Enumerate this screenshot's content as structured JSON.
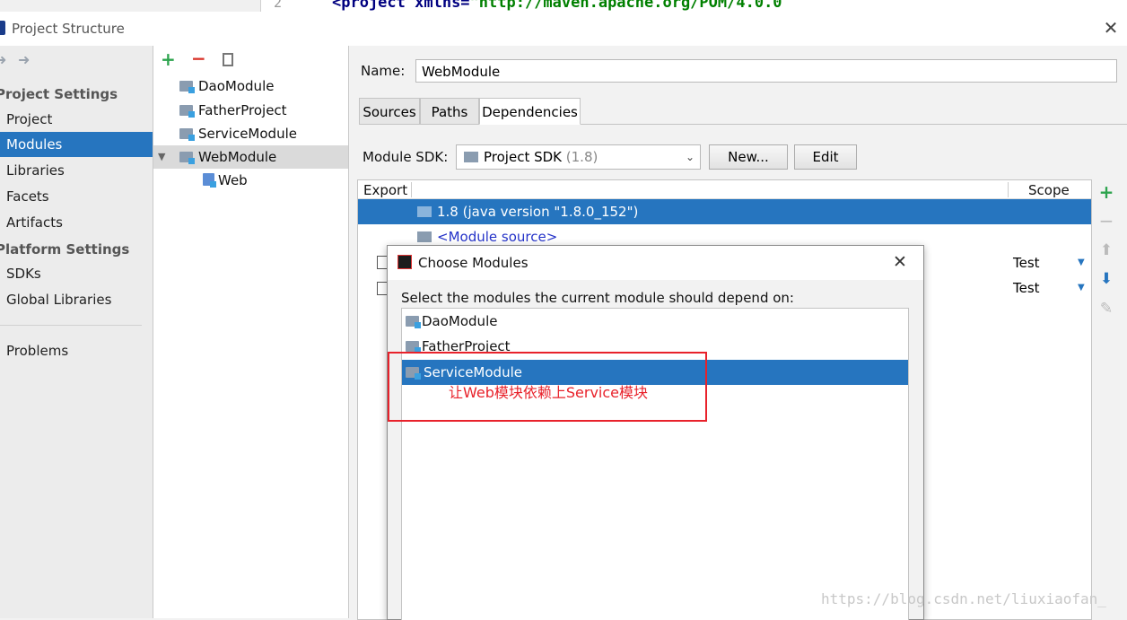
{
  "editor": {
    "line_number": "2",
    "code_prefix": "<project ",
    "code_attr": "xmlns=",
    "code_value": "\"http://maven.apache.org/POM/4.0.0"
  },
  "window": {
    "title": "Project Structure"
  },
  "nav": {
    "project_settings_header": "Project Settings",
    "project_items": [
      "Project",
      "Modules",
      "Libraries",
      "Facets",
      "Artifacts"
    ],
    "selected_item": "Modules",
    "platform_settings_header": "Platform Settings",
    "platform_items": [
      "SDKs",
      "Global Libraries"
    ],
    "problems": "Problems"
  },
  "tree": {
    "modules": [
      "DaoModule",
      "FatherProject",
      "ServiceModule",
      "WebModule"
    ],
    "selected": "WebModule",
    "child": "Web"
  },
  "details": {
    "name_label": "Name:",
    "name_value": "WebModule",
    "tabs": [
      "Sources",
      "Paths",
      "Dependencies"
    ],
    "active_tab": "Dependencies",
    "sdk_label": "Module SDK:",
    "sdk_value": "Project SDK",
    "sdk_version": "(1.8)",
    "new_button": "New...",
    "edit_button": "Edit",
    "col_export": "Export",
    "col_scope": "Scope",
    "dep_jdk": "1.8 (java version \"1.8.0_152\")",
    "dep_module_source": "<Module source>",
    "scope_row1": "Test",
    "scope_row2": "Test"
  },
  "dialog": {
    "title": "Choose Modules",
    "prompt": "Select the modules the current module should depend on:",
    "items": [
      "DaoModule",
      "FatherProject",
      "ServiceModule"
    ],
    "selected": "ServiceModule"
  },
  "annotation": {
    "text": "让Web模块依赖上Service模块",
    "color": "#e8222b"
  },
  "watermark": "https://blog.csdn.net/liuxiaofan_",
  "colors": {
    "selection": "#2675bf",
    "add_green": "#2da44e",
    "remove_red": "#d9342b"
  }
}
